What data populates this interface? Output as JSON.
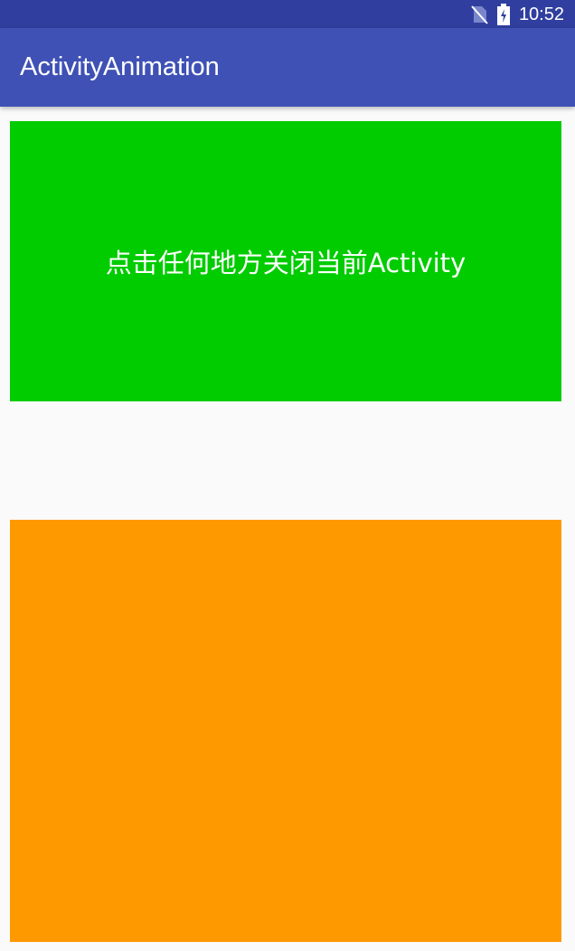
{
  "status_bar": {
    "time": "10:52",
    "background_color": "#303f9f",
    "icons": [
      "no-sim-icon",
      "battery-charging-icon"
    ]
  },
  "app_bar": {
    "title": "ActivityAnimation",
    "background_color": "#3f51b5"
  },
  "content": {
    "green_block": {
      "text": "点击任何地方关闭当前Activity",
      "color": "#00cc00"
    },
    "orange_block": {
      "color": "#ff9900"
    }
  }
}
